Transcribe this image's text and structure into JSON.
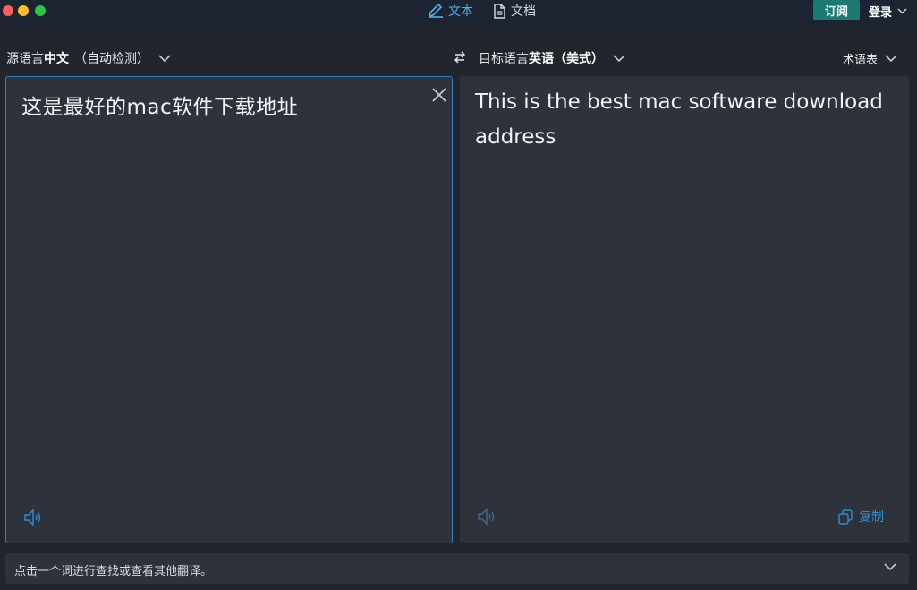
{
  "window": {
    "tabs": [
      {
        "label": "文本",
        "icon": "pencil-icon",
        "active": true
      },
      {
        "label": "文档",
        "icon": "document-icon",
        "active": false
      }
    ],
    "subscribe_label": "订阅",
    "login_label": "登录"
  },
  "source": {
    "prefix": "源语言",
    "language": "中文",
    "detect": "（自动检测）",
    "text": "这是最好的mac软件下载地址"
  },
  "target": {
    "prefix": "目标语言",
    "language": "英语（美式）",
    "text": "This is the best mac software download address",
    "copy_label": "复制"
  },
  "glossary_label": "术语表",
  "hint": "点击一个词进行查找或查看其他翻译。",
  "colors": {
    "accent": "#2e8fd8",
    "subscribe": "#1c7a75",
    "panel": "#2e323b",
    "background": "#22252c"
  }
}
